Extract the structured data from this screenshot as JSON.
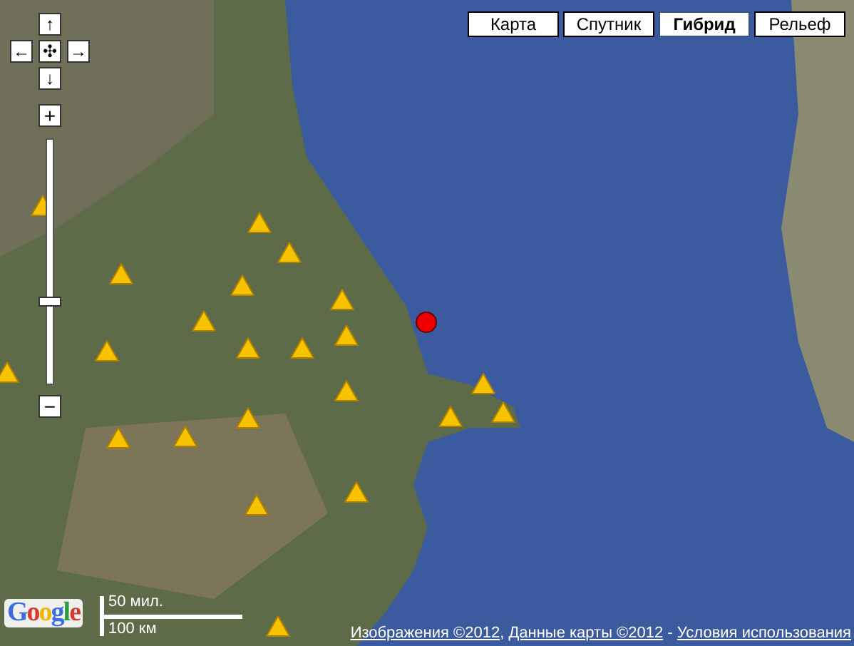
{
  "map_types": [
    {
      "label": "Карта",
      "selected": false
    },
    {
      "label": "Спутник",
      "selected": false
    },
    {
      "label": "Гибрид",
      "selected": true
    },
    {
      "label": "Рельеф",
      "selected": false
    }
  ],
  "pan_buttons": [
    {
      "symbol": "↑",
      "kind": "up"
    },
    {
      "symbol": "←",
      "kind": "left"
    },
    {
      "symbol": "✣",
      "kind": "center"
    },
    {
      "symbol": "→",
      "kind": "right"
    },
    {
      "symbol": "↓",
      "kind": "down"
    }
  ],
  "zoom": {
    "in_symbol": "+",
    "out_symbol": "−",
    "level": 0.34
  },
  "markers": [
    {
      "kind": "triangle"
    },
    {
      "kind": "triangle"
    },
    {
      "kind": "triangle"
    },
    {
      "kind": "triangle"
    },
    {
      "kind": "triangle"
    },
    {
      "kind": "triangle"
    },
    {
      "kind": "triangle"
    },
    {
      "kind": "triangle"
    },
    {
      "kind": "triangle"
    },
    {
      "kind": "triangle"
    },
    {
      "kind": "triangle"
    },
    {
      "kind": "triangle"
    },
    {
      "kind": "triangle"
    },
    {
      "kind": "triangle"
    },
    {
      "kind": "triangle"
    },
    {
      "kind": "triangle"
    },
    {
      "kind": "triangle"
    },
    {
      "kind": "triangle"
    },
    {
      "kind": "triangle"
    },
    {
      "kind": "triangle"
    },
    {
      "kind": "triangle"
    },
    {
      "kind": "triangle"
    },
    {
      "kind": "dot"
    }
  ],
  "logo": "Google",
  "scale": {
    "imperial": "50 мил.",
    "metric": "100 км"
  },
  "attribution": [
    {
      "text": "Изображения ©2012",
      "kind": "link"
    },
    {
      "text": ", ",
      "kind": "text"
    },
    {
      "text": "Данные карты ©2012",
      "kind": "link"
    },
    {
      "text": " - ",
      "kind": "text"
    },
    {
      "text": "Условия использования",
      "kind": "link"
    }
  ]
}
